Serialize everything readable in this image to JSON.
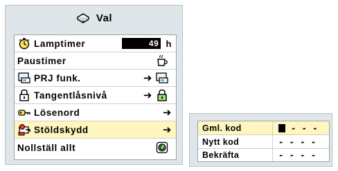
{
  "menu": {
    "title": "Val",
    "icon": "options-icon",
    "rows": [
      {
        "label": "Lamptimer",
        "icon": "timer-icon",
        "value": "49",
        "unit": "h"
      },
      {
        "label": "Paustimer",
        "icon": "cup-icon"
      },
      {
        "label": "PRJ funk.",
        "icon": "projector-icon",
        "arrow": "➜"
      },
      {
        "label": "Tangentlåsnivå",
        "icon": "lock-icon",
        "arrow": "➜"
      },
      {
        "label": "Lösenord",
        "icon": "key-icon",
        "arrow": "➜"
      },
      {
        "label": "Stöldskydd",
        "icon": "anti-theft-icon",
        "arrow": "➜",
        "selected": true
      },
      {
        "label": "Nollställ allt",
        "icon": "reset-icon"
      }
    ]
  },
  "code_panel": {
    "rows": [
      {
        "label": "Gml. kod",
        "digits": [
          "-",
          "-",
          "-"
        ],
        "selected": true
      },
      {
        "label": "Nytt kod",
        "digits": [
          "-",
          "-",
          "-",
          "-"
        ]
      },
      {
        "label": "Bekräfta",
        "digits": [
          "-",
          "-",
          "-",
          "-"
        ]
      }
    ]
  }
}
